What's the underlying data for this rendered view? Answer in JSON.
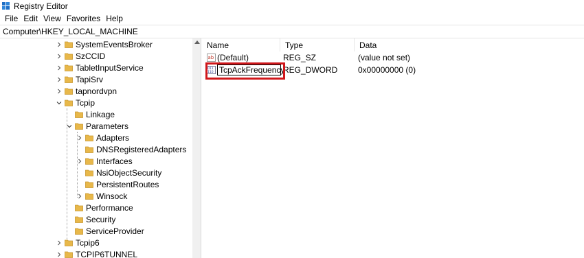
{
  "window": {
    "title": "Registry Editor"
  },
  "menu": [
    "File",
    "Edit",
    "View",
    "Favorites",
    "Help"
  ],
  "address": {
    "path": "Computer\\HKEY_LOCAL_MACHINE"
  },
  "tree": {
    "items": [
      {
        "label": "SystemEventsBroker",
        "expander": "collapsed"
      },
      {
        "label": "SzCCID",
        "expander": "collapsed"
      },
      {
        "label": "TabletInputService",
        "expander": "collapsed"
      },
      {
        "label": "TapiSrv",
        "expander": "collapsed"
      },
      {
        "label": "tapnordvpn",
        "expander": "collapsed"
      },
      {
        "label": "Tcpip",
        "expander": "expanded"
      },
      {
        "label": "Linkage",
        "expander": "none"
      },
      {
        "label": "Parameters",
        "expander": "expanded"
      },
      {
        "label": "Adapters",
        "expander": "collapsed"
      },
      {
        "label": "DNSRegisteredAdapters",
        "expander": "none"
      },
      {
        "label": "Interfaces",
        "expander": "collapsed"
      },
      {
        "label": "NsiObjectSecurity",
        "expander": "none"
      },
      {
        "label": "PersistentRoutes",
        "expander": "none"
      },
      {
        "label": "Winsock",
        "expander": "collapsed"
      },
      {
        "label": "Performance",
        "expander": "none"
      },
      {
        "label": "Security",
        "expander": "none"
      },
      {
        "label": "ServiceProvider",
        "expander": "none"
      },
      {
        "label": "Tcpip6",
        "expander": "collapsed"
      },
      {
        "label": "TCPIP6TUNNEL",
        "expander": "collapsed"
      }
    ]
  },
  "list": {
    "columns": {
      "name": "Name",
      "type": "Type",
      "data": "Data"
    },
    "rows": [
      {
        "name": "(Default)",
        "type": "REG_SZ",
        "data": "(value not set)",
        "icon": "string-value-icon"
      },
      {
        "name": "TcpAckFrequency",
        "type": "REG_DWORD",
        "data": "0x00000000 (0)",
        "icon": "binary-value-icon",
        "editing": true
      }
    ]
  },
  "colors": {
    "highlight": "#d0171b",
    "folder": "#e8b84a"
  }
}
